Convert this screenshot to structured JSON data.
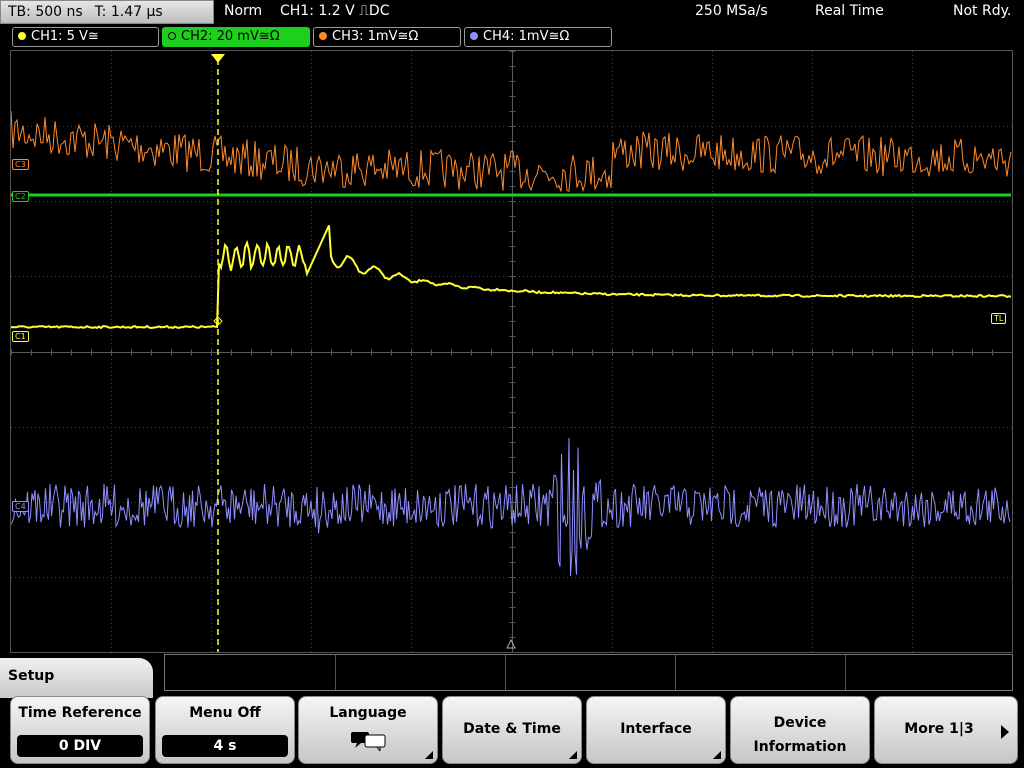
{
  "status_bar": {
    "timebase": "TB: 500 ns",
    "trigger_time": "T: 1.47 µs",
    "mode": "Norm",
    "trigger_info": "CH1: 1.2 V ⎍DC",
    "sample_rate": "250 MSa/s",
    "acq_mode": "Real Time",
    "state": "Not Rdy."
  },
  "channels": [
    {
      "label": "CH1: 5 V≅",
      "color": "#ffff33",
      "active": false
    },
    {
      "label": "CH2: 20 mV≅Ω",
      "color": "#1ed01e",
      "active": true
    },
    {
      "label": "CH3: 1mV≅Ω",
      "color": "#ff8a2a",
      "active": false
    },
    {
      "label": "CH4: 1mV≅Ω",
      "color": "#8f8fff",
      "active": false
    }
  ],
  "markers": {
    "c3": "C3",
    "c2": "C2",
    "c1": "C1",
    "c4": "C4",
    "trigger_level": "TL",
    "trigger_pos": "T"
  },
  "menu": {
    "title": "Setup",
    "softkeys": [
      {
        "label": "Time Reference",
        "value": "0 DIV"
      },
      {
        "label": "Menu Off",
        "value": "4 s"
      },
      {
        "label": "Language",
        "icon": "speech-bubble-icon"
      },
      {
        "label": "Date & Time"
      },
      {
        "label": "Interface"
      },
      {
        "label": "Device",
        "label2": "Information"
      },
      {
        "label": "More 1|3",
        "icon": "arrow-right-icon"
      }
    ]
  }
}
